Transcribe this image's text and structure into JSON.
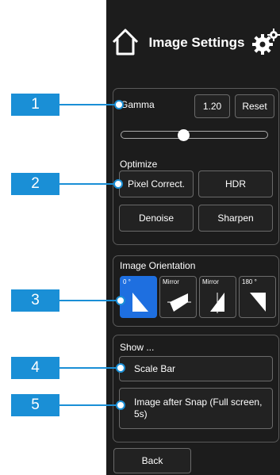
{
  "header": {
    "title": "Image Settings",
    "home_icon": "home-icon",
    "settings_icon": "gear-icon"
  },
  "gamma": {
    "label": "Gamma",
    "value": "1.20",
    "reset_label": "Reset",
    "slider_fraction": 0.42
  },
  "optimize": {
    "label": "Optimize",
    "buttons": [
      "Pixel Correct.",
      "HDR",
      "Denoise",
      "Sharpen"
    ]
  },
  "orientation": {
    "label": "Image Orientation",
    "options": [
      {
        "label": "0 °",
        "selected": true
      },
      {
        "label": "Mirror",
        "selected": false
      },
      {
        "label": "Mirror",
        "selected": false
      },
      {
        "label": "180 °",
        "selected": false
      }
    ]
  },
  "show": {
    "label": "Show ...",
    "scale_bar_label": "Scale Bar",
    "image_after_snap_label": "Image after Snap (Full screen, 5s)"
  },
  "back_label": "Back",
  "callouts": [
    "1",
    "2",
    "3",
    "4",
    "5"
  ],
  "colors": {
    "panel_bg": "#1c1c1c",
    "accent": "#1e6fe0",
    "callout": "#1a8fd6"
  }
}
